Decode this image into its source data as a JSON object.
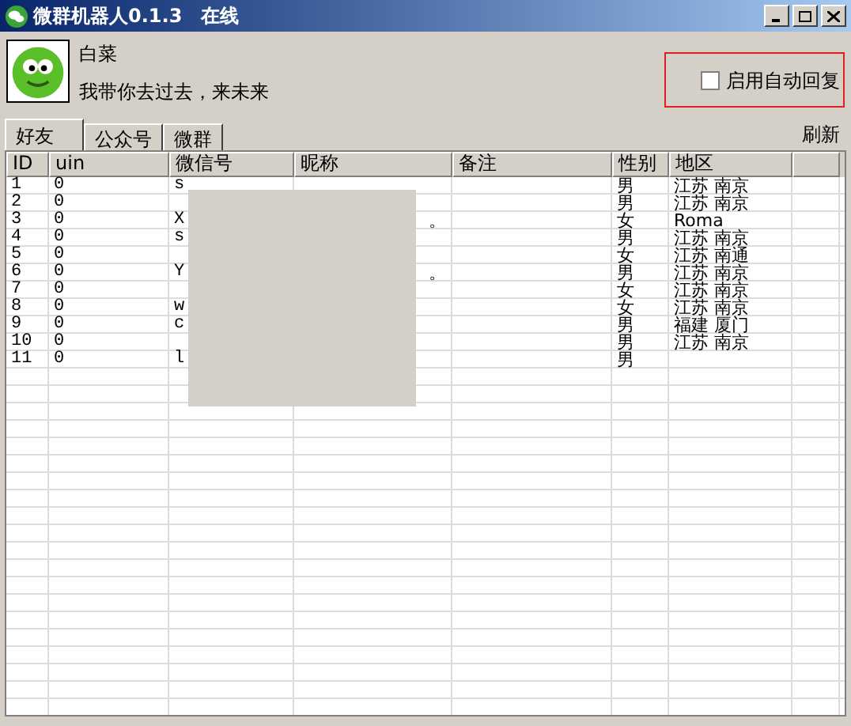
{
  "window": {
    "title": "微群机器人0.1.3　在线"
  },
  "profile": {
    "name": "白菜",
    "signature": "我带你去过去，来未来"
  },
  "auto_reply": {
    "label": "启用自动回复",
    "checked": false
  },
  "tabs": [
    {
      "label": "好友",
      "selected": true
    },
    {
      "label": "公众号",
      "selected": false
    },
    {
      "label": "微群",
      "selected": false
    }
  ],
  "refresh": "刷新",
  "table": {
    "columns": [
      "ID",
      "uin",
      "微信号",
      "昵称",
      "备注",
      "性别",
      "地区"
    ],
    "rows": [
      [
        "1",
        "0",
        "s",
        "",
        "",
        "男",
        "江苏 南京"
      ],
      [
        "2",
        "0",
        "",
        "",
        "",
        "男",
        "江苏 南京"
      ],
      [
        "3",
        "0",
        "X",
        "。",
        "",
        "女",
        "Roma"
      ],
      [
        "4",
        "0",
        "s",
        "",
        "",
        "男",
        "江苏 南京"
      ],
      [
        "5",
        "0",
        "",
        "",
        "",
        "女",
        "江苏 南通"
      ],
      [
        "6",
        "0",
        "Y",
        "。",
        "",
        "男",
        "江苏 南京"
      ],
      [
        "7",
        "0",
        "",
        "",
        "",
        "女",
        "江苏 南京"
      ],
      [
        "8",
        "0",
        "w",
        "",
        "",
        "女",
        "江苏 南京"
      ],
      [
        "9",
        "0",
        "c",
        "",
        "",
        "男",
        "福建 厦门"
      ],
      [
        "10",
        "0",
        "",
        "",
        "",
        "男",
        "江苏 南京"
      ],
      [
        "11",
        "0",
        "l",
        "",
        "",
        "男",
        ""
      ]
    ]
  }
}
